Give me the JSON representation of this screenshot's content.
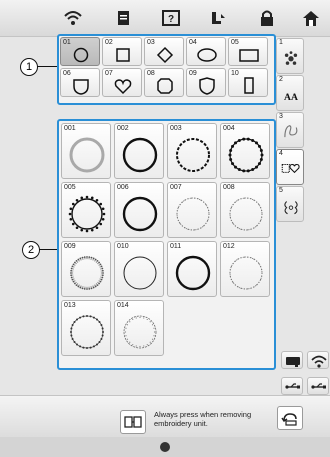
{
  "callouts": {
    "one": "1",
    "two": "2"
  },
  "toolbar": {
    "icons": [
      "wifi-icon",
      "document-icon",
      "help-icon",
      "thread-icon",
      "lock-icon",
      "home-icon"
    ]
  },
  "frame_shapes": [
    {
      "num": "01",
      "shape": "circle",
      "selected": true
    },
    {
      "num": "02",
      "shape": "square",
      "selected": false
    },
    {
      "num": "03",
      "shape": "diamond",
      "selected": false
    },
    {
      "num": "04",
      "shape": "oval",
      "selected": false
    },
    {
      "num": "05",
      "shape": "rectangle",
      "selected": false
    },
    {
      "num": "06",
      "shape": "shield-round",
      "selected": false
    },
    {
      "num": "07",
      "shape": "heart",
      "selected": false
    },
    {
      "num": "08",
      "shape": "octagon",
      "selected": false
    },
    {
      "num": "09",
      "shape": "shield",
      "selected": false
    },
    {
      "num": "10",
      "shape": "tall-rectangle",
      "selected": false
    }
  ],
  "frame_patterns": [
    {
      "num": "001",
      "style": "thick-gray"
    },
    {
      "num": "002",
      "style": "thick-black"
    },
    {
      "num": "003",
      "style": "dashed-black"
    },
    {
      "num": "004",
      "style": "beaded-black"
    },
    {
      "num": "005",
      "style": "scalloped-black"
    },
    {
      "num": "006",
      "style": "thick-black-2"
    },
    {
      "num": "007",
      "style": "dotted-fine"
    },
    {
      "num": "008",
      "style": "dotted-fine-2"
    },
    {
      "num": "009",
      "style": "zigzag-dense"
    },
    {
      "num": "010",
      "style": "thin-black"
    },
    {
      "num": "011",
      "style": "thick-black-3"
    },
    {
      "num": "012",
      "style": "dotted-fine-3"
    },
    {
      "num": "013",
      "style": "beaded-fine"
    },
    {
      "num": "014",
      "style": "zigzag-fine"
    }
  ],
  "side_tabs": [
    {
      "num": "1",
      "icon": "pattern-icon"
    },
    {
      "num": "2",
      "icon": "font-icon",
      "label": "AA"
    },
    {
      "num": "3",
      "icon": "decorative-letter-icon"
    },
    {
      "num": "4",
      "icon": "frame-shapes-icon",
      "active": true
    },
    {
      "num": "5",
      "icon": "emblem-icon"
    }
  ],
  "bottom_buttons": [
    "sewing-machine-icon",
    "wifi-icon",
    "usb-icon",
    "usb-icon-2"
  ],
  "message": "Always press when removing embroidery unit."
}
